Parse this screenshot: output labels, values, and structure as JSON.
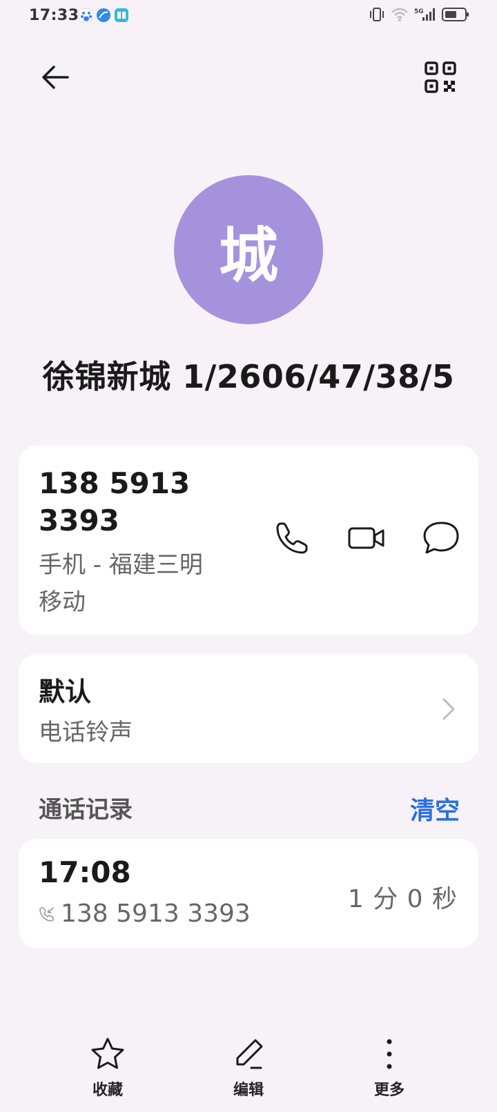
{
  "status_bar": {
    "time": "17:33",
    "network": "5G",
    "colors": {
      "baidu": "#3c7cf0",
      "browser": "#2f8ae8",
      "reader": "#36b8d8"
    }
  },
  "header": {
    "back_icon": "arrow-left-icon",
    "qr_icon": "qr-code-icon"
  },
  "contact": {
    "avatar_letter": "城",
    "avatar_color": "#a592dc",
    "name": "徐锦新城 1/2606/47/38/5"
  },
  "phone_card": {
    "number_line1": "138 5913",
    "number_line2": "3393",
    "desc_line1": "手机 - 福建三明",
    "desc_line2": "移动",
    "actions": [
      "phone-icon",
      "video-camera-icon",
      "message-bubble-icon"
    ]
  },
  "ringtone_card": {
    "value": "默认",
    "label": "电话铃声"
  },
  "call_log": {
    "title": "通话记录",
    "clear_label": "清空",
    "clear_color": "#2a6fe0",
    "entries": [
      {
        "time": "17:08",
        "number": "138 5913 3393",
        "duration": "1 分 0 秒"
      }
    ]
  },
  "bottom_nav": {
    "items": [
      {
        "label": "收藏",
        "icon": "star-icon"
      },
      {
        "label": "编辑",
        "icon": "pencil-icon"
      },
      {
        "label": "更多",
        "icon": "more-vertical-icon"
      }
    ]
  }
}
